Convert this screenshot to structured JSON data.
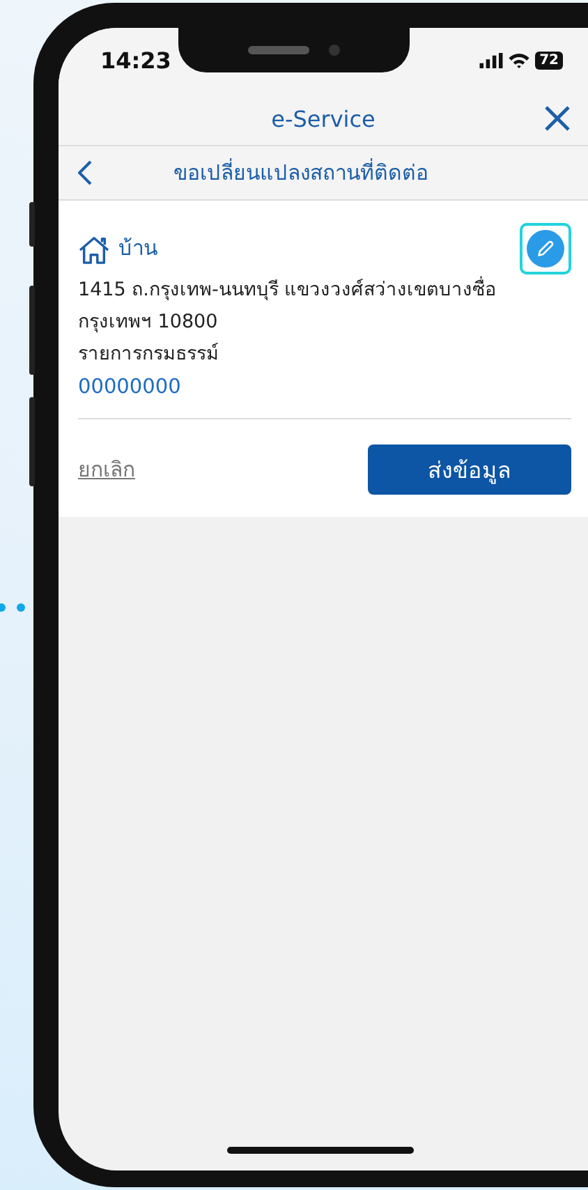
{
  "status_bar": {
    "time": "14:23",
    "battery": "72"
  },
  "header": {
    "title": "e-Service"
  },
  "sub_header": {
    "title": "ขอเปลี่ยนแปลงสถานที่ติดต่อ"
  },
  "address_card": {
    "label": "บ้าน",
    "edit_focused": true,
    "address_lines": [
      "1415 ถ.กรุงเทพ-นนทบุรี แขวงวงศ์สว่างเขตบางซื่อ",
      "กรุงเทพฯ 10800"
    ],
    "policy_label": "รายการกรมธรรม์",
    "policy_number": "00000000"
  },
  "actions": {
    "cancel": "ยกเลิก",
    "submit": "ส่งข้อมูล"
  }
}
